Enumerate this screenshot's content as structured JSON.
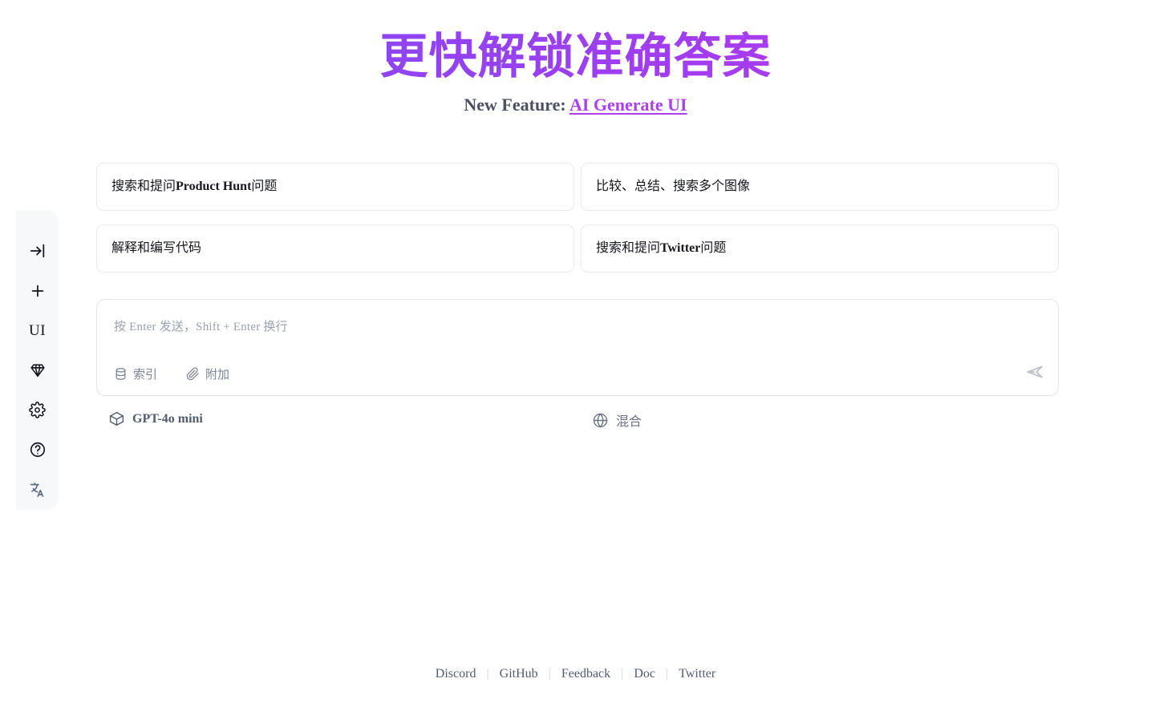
{
  "header": {
    "title": "更快解锁准确答案",
    "title_gradient_from": "#7b47f2",
    "title_gradient_to": "#c038f3",
    "subtitle_prefix": "New Feature:",
    "subtitle_link": "AI Generate UI",
    "subtitle_link_color": "#ad3ff0"
  },
  "sidebar": {
    "background": "#f7f8fa",
    "items": [
      {
        "icon": "expand-panel-icon",
        "label": ""
      },
      {
        "icon": "plus-icon",
        "label": ""
      },
      {
        "icon": "ui-text-icon",
        "label": "UI"
      },
      {
        "icon": "gem-icon",
        "label": ""
      },
      {
        "icon": "gear-icon",
        "label": ""
      },
      {
        "icon": "help-circle-icon",
        "label": ""
      },
      {
        "icon": "translate-icon",
        "label": ""
      }
    ]
  },
  "cards": [
    {
      "text_prefix": "搜索和提问 ",
      "text_bold": "Product Hunt",
      "text_suffix": " 问题"
    },
    {
      "text_prefix": "比较、总结、搜索多个图像",
      "text_bold": "",
      "text_suffix": ""
    },
    {
      "text_prefix": "解释和编写代码",
      "text_bold": "",
      "text_suffix": ""
    },
    {
      "text_prefix": "搜索和提问 ",
      "text_bold": "Twitter",
      "text_suffix": " 问题"
    }
  ],
  "composer": {
    "placeholder": "按 Enter 发送，Shift + Enter 换行",
    "value": "",
    "tools": [
      {
        "icon": "database-icon",
        "label": "索引"
      },
      {
        "icon": "paperclip-icon",
        "label": "附加"
      }
    ],
    "send_icon": "send-icon"
  },
  "model_row": {
    "model": {
      "icon": "cube-icon",
      "label": "GPT-4o mini"
    },
    "mode": {
      "icon": "globe-icon",
      "label": "混合"
    }
  },
  "footer": {
    "links": [
      "Discord",
      "GitHub",
      "Feedback",
      "Doc",
      "Twitter"
    ],
    "separator": "|"
  }
}
